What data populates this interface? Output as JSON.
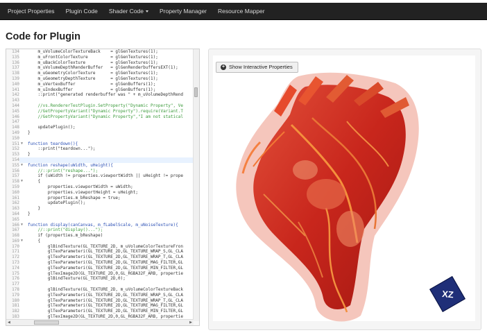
{
  "nav": {
    "items": [
      "Project Properties",
      "Plugin Code",
      "Shader Code",
      "Property Manager",
      "Resource Mapper"
    ],
    "background": "#222222"
  },
  "page_title": "Code for Plugin",
  "editor": {
    "lines": [
      {
        "n": "134",
        "t": "    m_uVolumeColorTextureBack    = glGenTextures(1);"
      },
      {
        "n": "135",
        "t": "    m_uFrontColorTexture         = glGenTextures(1);"
      },
      {
        "n": "136",
        "t": "    m_uBackColorTexture          = glGenTextures(1);"
      },
      {
        "n": "137",
        "t": "    m_uVolumeDepthRenderBuffer   = glGenRenderbuffersEXT(1);"
      },
      {
        "n": "138",
        "t": "    m_uGeometryColorTexture      = glGenTextures(1);"
      },
      {
        "n": "139",
        "t": "    m_uGeometryDepthTexture      = glGenTextures(1);"
      },
      {
        "n": "140",
        "t": "    m_uVertexBuffer              = glGenBuffers(1);"
      },
      {
        "n": "141",
        "t": "    m_uIndexBuffer               = glGenBuffers(1);"
      },
      {
        "n": "142",
        "t": "    ::print(\"generated renderbuffer was \" + m_uVolumeDepthRend"
      },
      {
        "n": "143",
        "t": ""
      },
      {
        "n": "144",
        "t": "    //vs.RendererTestPlugin.SetProperty(\"Dynamic Property\", Ve"
      },
      {
        "n": "145",
        "t": "    //GetPropertyVariant(\"Dynamic Property\").require(Variant.T"
      },
      {
        "n": "146",
        "t": "    //GetPropertyVariant(\"Dynamic Property\",\"I am not statical"
      },
      {
        "n": "147",
        "t": ""
      },
      {
        "n": "148",
        "t": "    updatePlugin();"
      },
      {
        "n": "149",
        "t": "}"
      },
      {
        "n": "150",
        "t": ""
      },
      {
        "n": "151",
        "t": "function teardown(){"
      },
      {
        "n": "152",
        "t": "    ::print(\"teardown...\");"
      },
      {
        "n": "153",
        "t": "}"
      },
      {
        "n": "154",
        "t": ""
      },
      {
        "n": "155",
        "t": "function reshape(uWidth, uHeight){"
      },
      {
        "n": "156",
        "t": "    //::print(\"reshape...\");"
      },
      {
        "n": "157",
        "t": "    if (uWidth != properties.viewportWidth || uHeight != prope"
      },
      {
        "n": "158",
        "t": "    {"
      },
      {
        "n": "159",
        "t": "        properties.viewportWidth = uWidth;"
      },
      {
        "n": "160",
        "t": "        properties.viewportHeight = uHeight;"
      },
      {
        "n": "161",
        "t": "        properties.m_bReshape = true;"
      },
      {
        "n": "162",
        "t": "        updatePlugin();"
      },
      {
        "n": "163",
        "t": "    }"
      },
      {
        "n": "164",
        "t": "}"
      },
      {
        "n": "165",
        "t": ""
      },
      {
        "n": "166",
        "t": "function display(canCanvas, m_fLabelScale, m_uNoiseTexture){"
      },
      {
        "n": "167",
        "t": "    //::print(\"display()...\");"
      },
      {
        "n": "168",
        "t": "    if (properties.m_bReshape)"
      },
      {
        "n": "169",
        "t": "    {"
      },
      {
        "n": "170",
        "t": "        glBindTexture(GL_TEXTURE_2D, m_uVolumeColorTextureFron"
      },
      {
        "n": "171",
        "t": "        glTexParameteri(GL_TEXTURE_2D,GL_TEXTURE_WRAP_S,GL_CLA"
      },
      {
        "n": "172",
        "t": "        glTexParameteri(GL_TEXTURE_2D,GL_TEXTURE_WRAP_T,GL_CLA"
      },
      {
        "n": "173",
        "t": "        glTexParameteri(GL_TEXTURE_2D,GL_TEXTURE_MAG_FILTER,GL"
      },
      {
        "n": "174",
        "t": "        glTexParameteri(GL_TEXTURE_2D,GL_TEXTURE_MIN_FILTER,GL"
      },
      {
        "n": "175",
        "t": "        glTexImage2D(GL_TEXTURE_2D,0,GL_RGBA32F_ARB, propertie"
      },
      {
        "n": "176",
        "t": "        glBindTexture(GL_TEXTURE_2D,0);"
      },
      {
        "n": "177",
        "t": ""
      },
      {
        "n": "178",
        "t": "        glBindTexture(GL_TEXTURE_2D, m_uVolumeColorTextureBack"
      },
      {
        "n": "179",
        "t": "        glTexParameteri(GL_TEXTURE_2D,GL_TEXTURE_WRAP_S,GL_CLA"
      },
      {
        "n": "180",
        "t": "        glTexParameteri(GL_TEXTURE_2D,GL_TEXTURE_WRAP_T,GL_CLA"
      },
      {
        "n": "181",
        "t": "        glTexParameteri(GL_TEXTURE_2D,GL_TEXTURE_MAG_FILTER,GL"
      },
      {
        "n": "182",
        "t": "        glTexParameteri(GL_TEXTURE_2D,GL_TEXTURE_MIN_FILTER,GL"
      },
      {
        "n": "183",
        "t": "        glTexImage2D(GL_TEXTURE_2D,0,GL_RGBA32F_ARB, propertie"
      },
      {
        "n": "184",
        "t": "        glBindTexture(GL_TEXTURE_2D,0);"
      }
    ],
    "fold_markers": [
      "151",
      "155",
      "158",
      "166",
      "169"
    ],
    "active_line": "154"
  },
  "viewer": {
    "button_label": "Show Interactive Properties",
    "button_icon": "plus-circle-icon",
    "cube_label": "XZ",
    "cube_color": "#1f2f78",
    "render_colors": [
      "#d62a1e",
      "#f06a2a",
      "#f2b2a2"
    ]
  }
}
